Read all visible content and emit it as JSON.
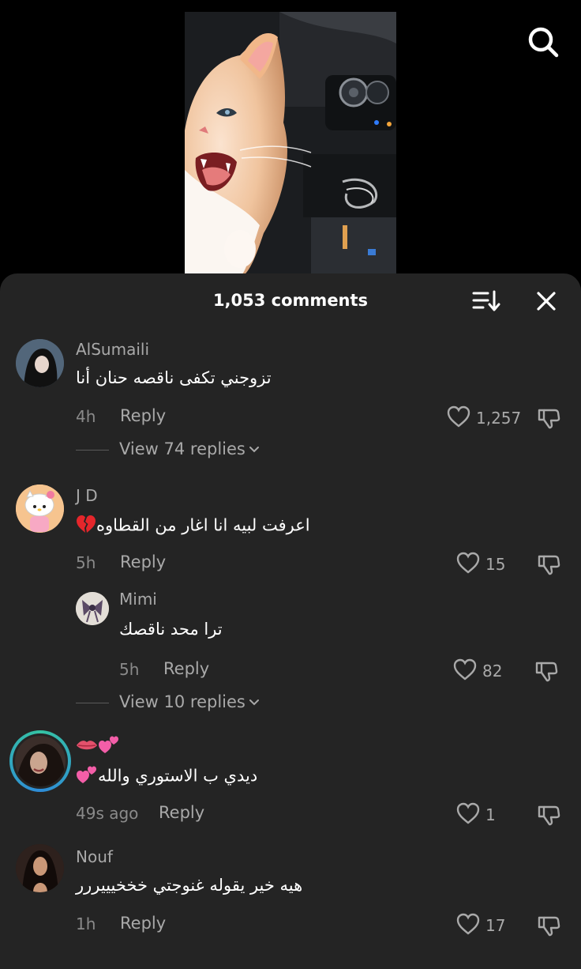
{
  "header": {
    "comment_count": "1,053 comments"
  },
  "icons": {
    "search": "search-icon",
    "sort": "sort-icon",
    "close": "close-icon",
    "heart": "heart-icon",
    "dislike": "dislike-icon",
    "chevron": "chevron-down-icon",
    "broken_heart": "broken-heart-emoji",
    "two_hearts": "two-hearts-emoji",
    "lips": "lips-emoji"
  },
  "colors": {
    "sheet_bg": "#242424",
    "muted_text": "#a9a9a9",
    "username": "#a9a9a9"
  },
  "comments": [
    {
      "username": "AlSumaili",
      "text": "تزوجني تكفى ناقصه حنان أنا",
      "time": "4h",
      "reply_label": "Reply",
      "likes": "1,257",
      "view_replies": "View 74 replies"
    },
    {
      "username": "J D",
      "text": "اعرفت لبيه انا اغار من القطاوه",
      "time": "5h",
      "reply_label": "Reply",
      "likes": "15",
      "reply": {
        "username": "Mimi",
        "text": "ترا محد ناقصك",
        "time": "5h",
        "reply_label": "Reply",
        "likes": "82"
      },
      "view_replies": "View 10 replies"
    },
    {
      "username": "",
      "text": "ديدي ب الاستوري والله",
      "time": "49s ago",
      "reply_label": "Reply",
      "likes": "1"
    },
    {
      "username": "Nouf",
      "text": "هيه خير يقوله غنوجتي خخخيييررر",
      "time": "1h",
      "reply_label": "Reply",
      "likes": "17"
    }
  ]
}
